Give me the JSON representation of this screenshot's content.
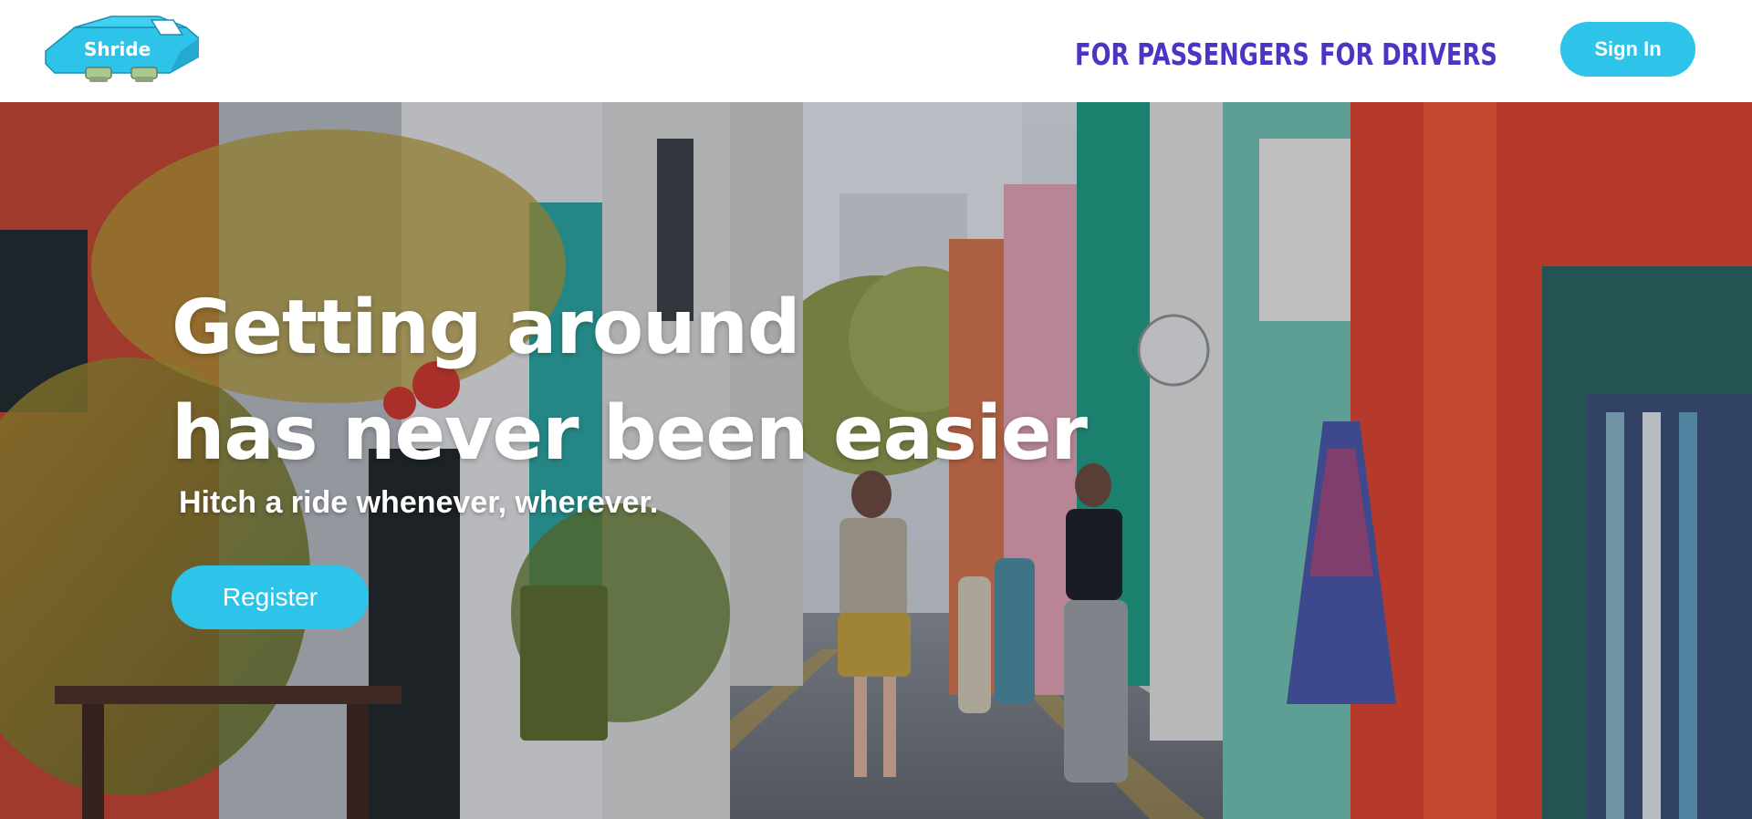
{
  "header": {
    "logo_text": "Shride",
    "nav": {
      "passengers_label": "FOR PASSENGERS",
      "drivers_label": "FOR DRIVERS"
    },
    "signin_label": "Sign In"
  },
  "hero": {
    "title_line1": "Getting around",
    "title_line2": "has never been easier",
    "subtitle": "Hitch a ride whenever, wherever.",
    "register_label": "Register",
    "background_image": "colorful-shophouse-street-photo"
  },
  "colors": {
    "accent": "#2ec4ea",
    "nav_link": "#4b35c4",
    "header_bg": "#ffffff",
    "hero_text": "#ffffff"
  },
  "icons": {
    "logo": "car-logo-icon"
  }
}
